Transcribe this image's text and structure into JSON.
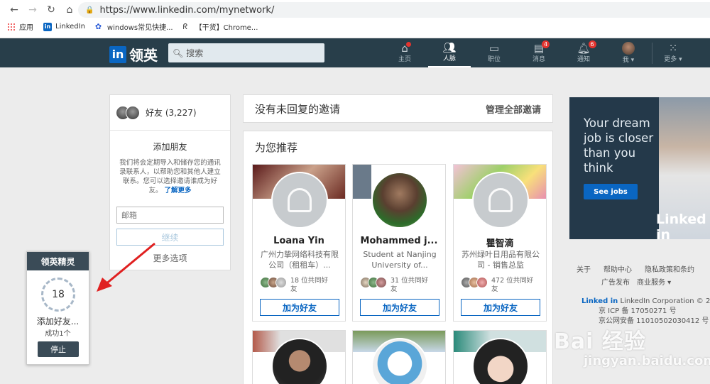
{
  "browser": {
    "url": "https://www.linkedin.com/mynetwork/",
    "bookmarks": [
      "应用",
      "LinkedIn",
      "windows常见快捷...",
      "【干货】Chrome..."
    ]
  },
  "header": {
    "logo_text": "领英",
    "logo_in": "in",
    "search_placeholder": "搜索",
    "nav": [
      {
        "label": "主页",
        "icon": "home-icon",
        "badge": ""
      },
      {
        "label": "人脉",
        "icon": "people-icon",
        "badge": ""
      },
      {
        "label": "职位",
        "icon": "briefcase-icon",
        "badge": ""
      },
      {
        "label": "消息",
        "icon": "message-icon",
        "badge": "4"
      },
      {
        "label": "通知",
        "icon": "bell-icon",
        "badge": "6"
      },
      {
        "label": "我 ▾",
        "icon": "avatar",
        "badge": ""
      },
      {
        "label": "更多 ▾",
        "icon": "grid-icon",
        "badge": ""
      }
    ]
  },
  "left": {
    "friends": "好友 (3,227)",
    "add_title": "添加朋友",
    "add_desc": "我们将会定期导入和储存您的通讯录联系人，以帮助您和其他人建立联系。您可以选择邀请谁成为好友。",
    "learn_more": "了解更多",
    "email_placeholder": "邮箱",
    "continue": "继续",
    "more_options": "更多选项"
  },
  "invitations": {
    "title": "没有未回复的邀请",
    "manage": "管理全部邀请"
  },
  "recommend": {
    "title": "为您推荐",
    "people": [
      {
        "name": "Loana Yin",
        "headline": "广州力挚网络科技有限公司（租租车）...",
        "mutual": "18 位共同好友",
        "add": "加为好友"
      },
      {
        "name": "Mohammed j...",
        "headline": "Student at Nanjing University of...",
        "mutual": "31 位共同好友",
        "add": "加为好友"
      },
      {
        "name": "瞿智滴",
        "headline": "苏州绿叶日用品有限公司 - 销售总监",
        "mutual": "472 位共同好友",
        "add": "加为好友"
      }
    ]
  },
  "ad": {
    "text": "Your dream job is closer than you think",
    "button": "See jobs",
    "brand": "Linked in"
  },
  "footer": {
    "row1": [
      "关于",
      "帮助中心",
      "隐私政策和条约"
    ],
    "row2": [
      "广告发布",
      "商业服务 ▾"
    ],
    "copyright_brand": "Linked in",
    "copyright": "LinkedIn Corporation © 201",
    "icp": "京 ICP 备 17050271 号",
    "gongan": "京公网安备 11010502030412 号"
  },
  "popup": {
    "title": "领英精灵",
    "count": "18",
    "status": "添加好友...",
    "success": "成功1个",
    "stop": "停止"
  },
  "watermark": {
    "big": "Bai 经验",
    "sub": "jingyan.baidu.com"
  }
}
